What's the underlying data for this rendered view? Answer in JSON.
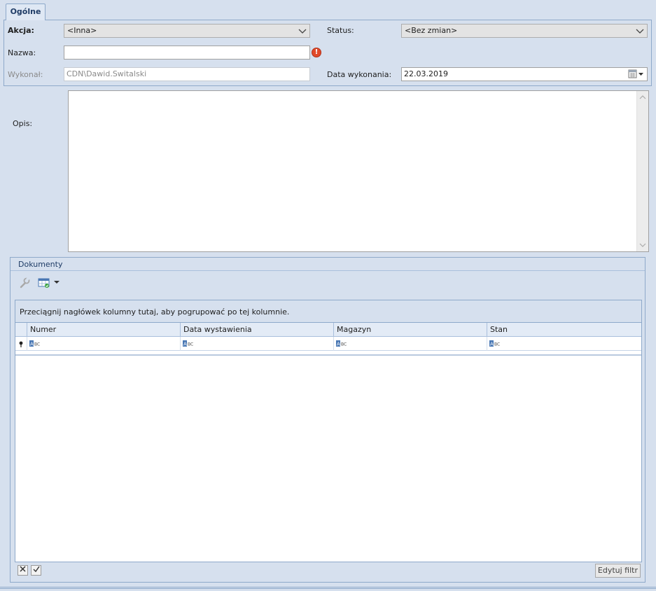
{
  "tabs": [
    {
      "label": "Ogólne",
      "active": true
    }
  ],
  "form": {
    "akcja": {
      "label": "Akcja:",
      "value": "<Inna>"
    },
    "status": {
      "label": "Status:",
      "value": "<Bez zmian>"
    },
    "nazwa": {
      "label": "Nazwa:",
      "value": ""
    },
    "wykonal": {
      "label": "Wykonał:",
      "value": "CDN\\Dawid.Switalski"
    },
    "data_wykonania": {
      "label": "Data wykonania:",
      "value": "22.03.2019"
    },
    "opis": {
      "label": "Opis:",
      "value": ""
    }
  },
  "documents": {
    "title": "Dokumenty",
    "group_hint": "Przeciągnij nagłówek kolumny tutaj, aby pogrupować po tej kolumnie.",
    "columns": [
      "Numer",
      "Data wystawienia",
      "Magazyn",
      "Stan"
    ],
    "rows": [],
    "footer": {
      "edit_filter_label": "Edytuj filtr"
    }
  },
  "icons": {
    "error": "exclamation-circle-icon",
    "calendar": "calendar-icon",
    "wrench": "wrench-icon",
    "table_refresh": "table-refresh-icon",
    "filter_text": "abc-text-filter-icon",
    "pin": "pin-icon"
  },
  "colors": {
    "background": "#d6e0ee",
    "border": "#8ea9ca",
    "error": "#e14a2a",
    "header_text": "#1f3c66"
  }
}
